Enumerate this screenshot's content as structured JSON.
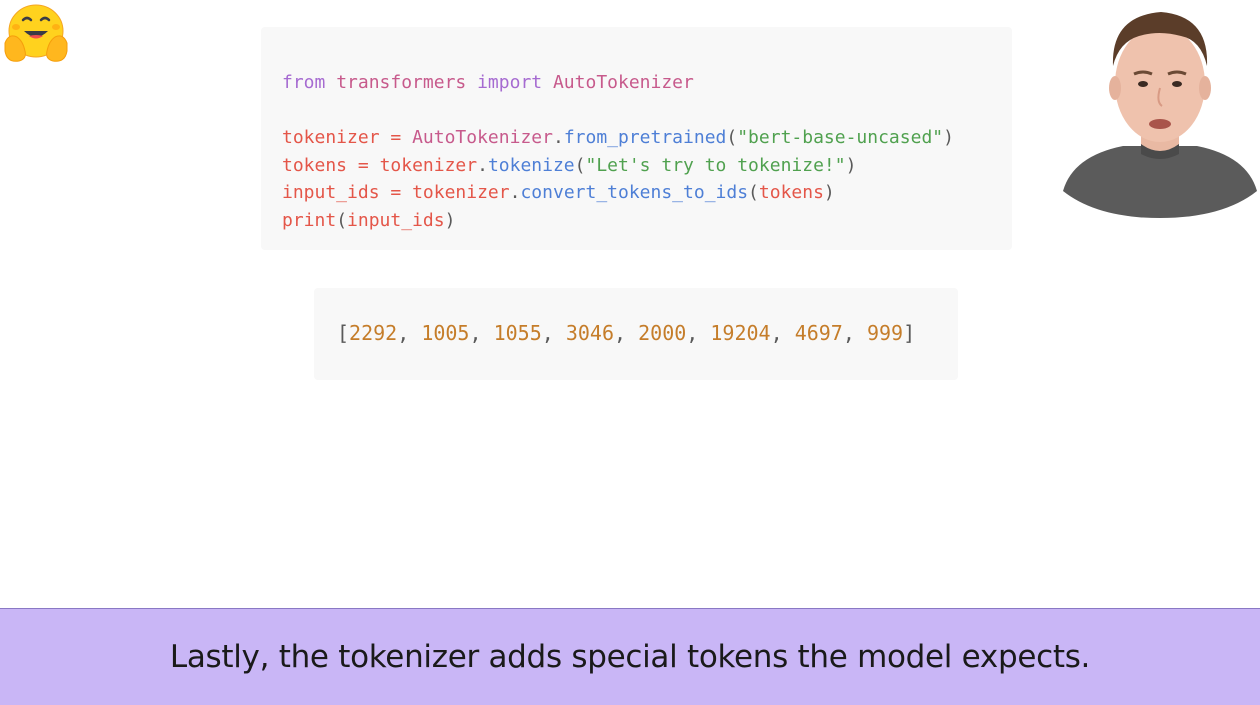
{
  "logo": {
    "icon": "hugging-face-emoji"
  },
  "code": {
    "line1": {
      "kw_from": "from",
      "module": "transformers",
      "kw_import": "import",
      "cls": "AutoTokenizer"
    },
    "line2": {
      "var": "tokenizer",
      "op": "=",
      "cls": "AutoTokenizer",
      "fn": "from_pretrained",
      "arg": "\"bert-base-uncased\""
    },
    "line3": {
      "var": "tokens",
      "op": "=",
      "obj": "tokenizer",
      "fn": "tokenize",
      "arg": "\"Let's try to tokenize!\""
    },
    "line4": {
      "var": "input_ids",
      "op": "=",
      "obj": "tokenizer",
      "fn": "convert_tokens_to_ids",
      "arg": "tokens"
    },
    "line5": {
      "fn": "print",
      "arg": "input_ids"
    }
  },
  "output": {
    "ids": [
      "2292",
      "1005",
      "1055",
      "3046",
      "2000",
      "19204",
      "4697",
      "999"
    ]
  },
  "presenter": {
    "icon": "presenter-video"
  },
  "caption": {
    "text": "Lastly, the tokenizer adds special tokens the model expects."
  },
  "colors": {
    "caption_bg": "#c9b6f6",
    "code_bg": "#f8f8f8",
    "keyword": "#a66bd1",
    "variable": "#e45649",
    "function": "#4e7fd6",
    "string": "#50a14f",
    "number": "#c57d2a"
  }
}
